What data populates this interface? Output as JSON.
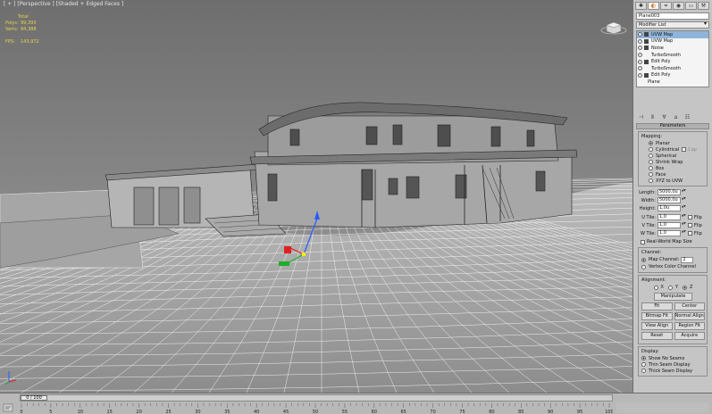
{
  "viewport": {
    "label": "[ + ] [Perspective ] [Shaded + Edged Faces ]",
    "stats": {
      "total_label": "Total",
      "polys_label": "Polys:",
      "polys_value": "99,393",
      "verts_label": "Verts:",
      "verts_value": "94,388",
      "fps_label": "FPS:",
      "fps_value": "143,972"
    }
  },
  "command_panel": {
    "tabs": [
      "create-icon",
      "modify-icon",
      "hierarchy-icon",
      "motion-icon",
      "display-icon",
      "utilities-icon"
    ],
    "object_name": "Plane003",
    "modifier_list_label": "Modifier List",
    "stack": [
      {
        "label": "UVW Map",
        "selected": true,
        "expandable": true
      },
      {
        "label": "UVW Map",
        "selected": false,
        "expandable": true
      },
      {
        "label": "Noise",
        "selected": false,
        "expandable": true
      },
      {
        "label": "TurboSmooth",
        "selected": false,
        "expandable": false
      },
      {
        "label": "Edit Poly",
        "selected": false,
        "expandable": true
      },
      {
        "label": "TurboSmooth",
        "selected": false,
        "expandable": false
      },
      {
        "label": "Edit Poly",
        "selected": false,
        "expandable": true
      }
    ],
    "stack_base": "Plane",
    "parameters_title": "Parameters",
    "mapping": {
      "label": "Mapping:",
      "options": [
        {
          "label": "Planar",
          "on": true
        },
        {
          "label": "Cylindrical",
          "on": false,
          "cap_label": "Cap"
        },
        {
          "label": "Spherical",
          "on": false
        },
        {
          "label": "Shrink Wrap",
          "on": false
        },
        {
          "label": "Box",
          "on": false
        },
        {
          "label": "Face",
          "on": false
        },
        {
          "label": "XYZ to UVW",
          "on": false
        }
      ]
    },
    "dimensions": [
      {
        "label": "Length:",
        "value": "5000,0u"
      },
      {
        "label": "Width:",
        "value": "5000,0u"
      },
      {
        "label": "Height:",
        "value": "1,0u"
      }
    ],
    "tiles": [
      {
        "label": "U Tile:",
        "value": "1,0",
        "flip": "Flip"
      },
      {
        "label": "V Tile:",
        "value": "1,0",
        "flip": "Flip"
      },
      {
        "label": "W Tile:",
        "value": "1,0",
        "flip": "Flip"
      }
    ],
    "real_world": "Real-World Map Size",
    "channel": {
      "label": "Channel:",
      "map_channel_label": "Map Channel:",
      "map_channel_value": "2",
      "vertex_color_label": "Vertex Color Channel"
    },
    "alignment": {
      "label": "Alignment:",
      "x": "X",
      "y": "Y",
      "z": "Z",
      "manipulate": "Manipulate",
      "fit": "Fit",
      "center": "Center",
      "bitmap_fit": "Bitmap Fit",
      "normal_align": "Normal Align",
      "view_align": "View Align",
      "region_fit": "Region Fit",
      "reset": "Reset",
      "acquire": "Acquire"
    },
    "display": {
      "label": "Display:",
      "options": [
        {
          "label": "Show No Seams",
          "on": true
        },
        {
          "label": "Thin Seam Display",
          "on": false
        },
        {
          "label": "Thick Seam Display",
          "on": false
        }
      ]
    }
  },
  "timeline": {
    "frame_label": "0 / 100",
    "ticks": [
      "0",
      "5",
      "10",
      "15",
      "20",
      "25",
      "30",
      "35",
      "40",
      "45",
      "50",
      "55",
      "60",
      "65",
      "70",
      "75",
      "80",
      "85",
      "90",
      "95",
      "100"
    ]
  },
  "colors": {
    "sky": "#7d7d7d",
    "ground": "#9a9a9a",
    "wire": "#ffffff",
    "stats": "#e8d44a",
    "selected": "#8fb4da",
    "active_tab": "#d46a00"
  }
}
